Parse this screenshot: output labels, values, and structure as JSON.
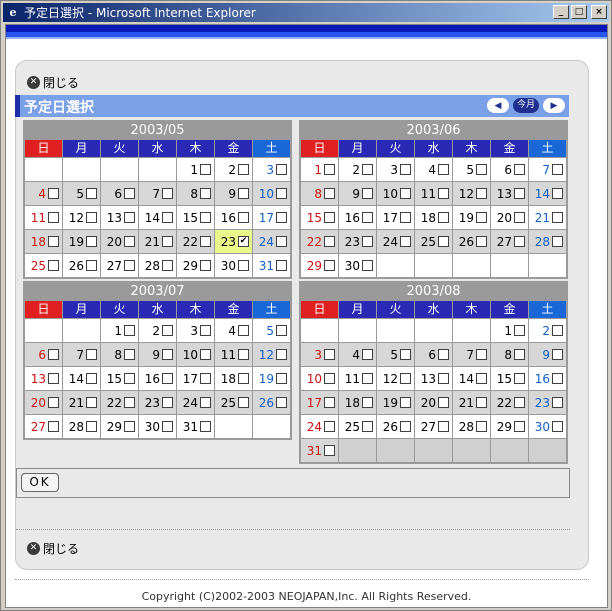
{
  "window": {
    "title": "予定日選択 - Microsoft Internet Explorer",
    "minimize": "_",
    "maximize": "□",
    "close": "×"
  },
  "close_label": "閉じる",
  "header": {
    "title": "予定日選択",
    "today_label": "今月"
  },
  "weekdays": [
    "日",
    "月",
    "火",
    "水",
    "木",
    "金",
    "土"
  ],
  "months": [
    {
      "title": "2003/05",
      "lead": 4,
      "days": 31,
      "checked": [
        23
      ],
      "selected": 23
    },
    {
      "title": "2003/06",
      "lead": 0,
      "days": 30,
      "checked": [],
      "selected": null
    },
    {
      "title": "2003/07",
      "lead": 2,
      "days": 31,
      "checked": [],
      "selected": null
    },
    {
      "title": "2003/08",
      "lead": 5,
      "days": 31,
      "checked": [],
      "selected": null
    }
  ],
  "ok_label": "OK",
  "footer": "Copyright (C)2002-2003 NEOJAPAN,Inc. All Rights Reserved.",
  "colors": {
    "header_bg": "#7aa0e8",
    "sunday": "#e02020",
    "saturday": "#1a68d8",
    "weekday_header": "#2929b5",
    "selected_day": "#e8f88a"
  }
}
